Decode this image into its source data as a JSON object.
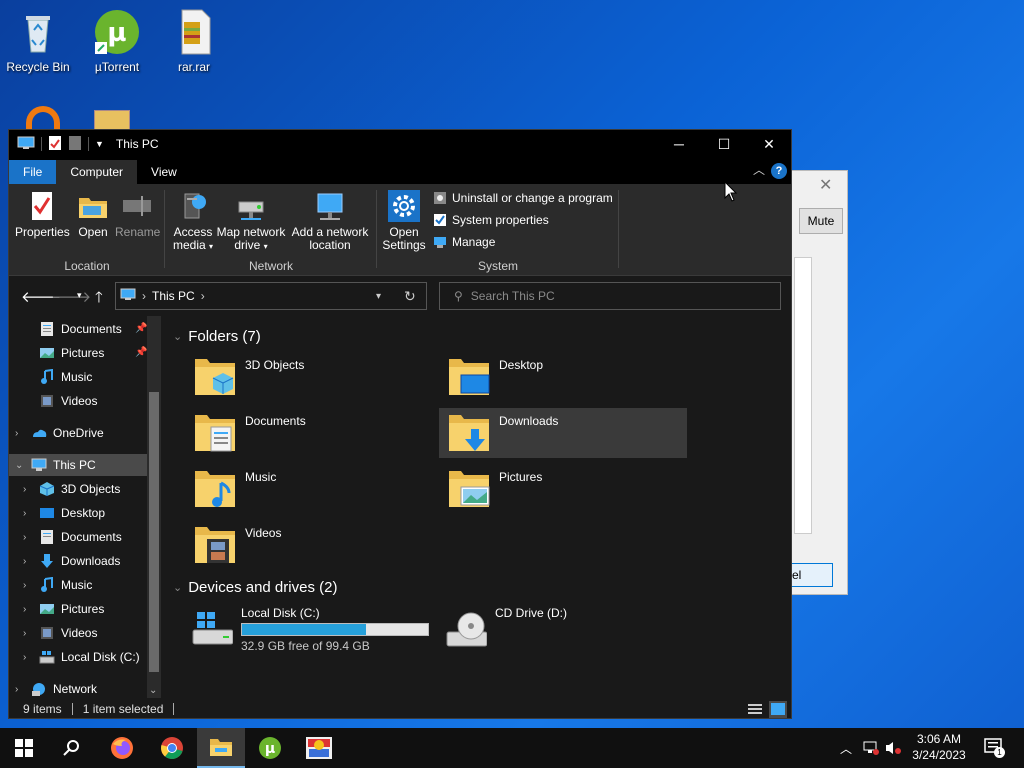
{
  "desktop": {
    "icons": [
      {
        "label": "Recycle Bin",
        "icon": "recycle-bin-icon"
      },
      {
        "label": "µTorrent",
        "icon": "utorrent-icon"
      },
      {
        "label": "rar.rar",
        "icon": "winrar-archive-icon"
      }
    ]
  },
  "bg_dialog": {
    "mute_label": "Mute",
    "partial_button_label": "el"
  },
  "window": {
    "title": "This PC",
    "tabs": {
      "file": "File",
      "computer": "Computer",
      "view": "View"
    },
    "help": "?"
  },
  "ribbon": {
    "location": {
      "name": "Location",
      "properties": "Properties",
      "open": "Open",
      "rename": "Rename"
    },
    "network": {
      "name": "Network",
      "access_media": "Access media",
      "map_network_drive": "Map network drive",
      "add_network_location": "Add a network location"
    },
    "system": {
      "name": "System",
      "open_settings": "Open Settings",
      "uninstall": "Uninstall or change a program",
      "system_properties": "System properties",
      "manage": "Manage"
    }
  },
  "address": {
    "path": "This PC",
    "search_placeholder": "Search This PC"
  },
  "navpane": {
    "quick_items": [
      {
        "label": "Documents",
        "icon": "documents-icon"
      },
      {
        "label": "Pictures",
        "icon": "pictures-icon"
      },
      {
        "label": "Music",
        "icon": "music-icon"
      },
      {
        "label": "Videos",
        "icon": "videos-icon"
      }
    ],
    "onedrive": "OneDrive",
    "this_pc": "This PC",
    "pc_items": [
      {
        "label": "3D Objects",
        "icon": "3d-objects-icon"
      },
      {
        "label": "Desktop",
        "icon": "desktop-icon"
      },
      {
        "label": "Documents",
        "icon": "documents-icon"
      },
      {
        "label": "Downloads",
        "icon": "downloads-icon"
      },
      {
        "label": "Music",
        "icon": "music-icon"
      },
      {
        "label": "Pictures",
        "icon": "pictures-icon"
      },
      {
        "label": "Videos",
        "icon": "videos-icon"
      },
      {
        "label": "Local Disk (C:)",
        "icon": "drive-icon"
      }
    ],
    "network": "Network"
  },
  "content": {
    "folders_header": "Folders (7)",
    "folders": [
      {
        "label": "3D Objects",
        "icon": "3d-objects-folder-icon"
      },
      {
        "label": "Desktop",
        "icon": "desktop-folder-icon"
      },
      {
        "label": "Documents",
        "icon": "documents-folder-icon"
      },
      {
        "label": "Downloads",
        "icon": "downloads-folder-icon",
        "selected": true
      },
      {
        "label": "Music",
        "icon": "music-folder-icon"
      },
      {
        "label": "Pictures",
        "icon": "pictures-folder-icon"
      },
      {
        "label": "Videos",
        "icon": "videos-folder-icon"
      }
    ],
    "drives_header": "Devices and drives (2)",
    "drives": [
      {
        "label": "Local Disk (C:)",
        "free": "32.9 GB free of 99.4 GB",
        "used_fraction": 0.669
      },
      {
        "label": "CD Drive (D:)"
      }
    ]
  },
  "status": {
    "items": "9 items",
    "selected": "1 item selected"
  },
  "taskbar": {
    "apps": [
      "start-icon",
      "search-icon",
      "firefox-icon",
      "chrome-icon",
      "file-explorer-icon",
      "utorrent-icon",
      "sonic-game-icon"
    ],
    "time": "3:06 AM",
    "date": "3/24/2023",
    "notification_count": "1"
  },
  "colors": {
    "accent": "#1a73c8",
    "progress": "#26a0da",
    "window_bg": "#191919",
    "ribbon_bg": "#2b2b2b"
  }
}
